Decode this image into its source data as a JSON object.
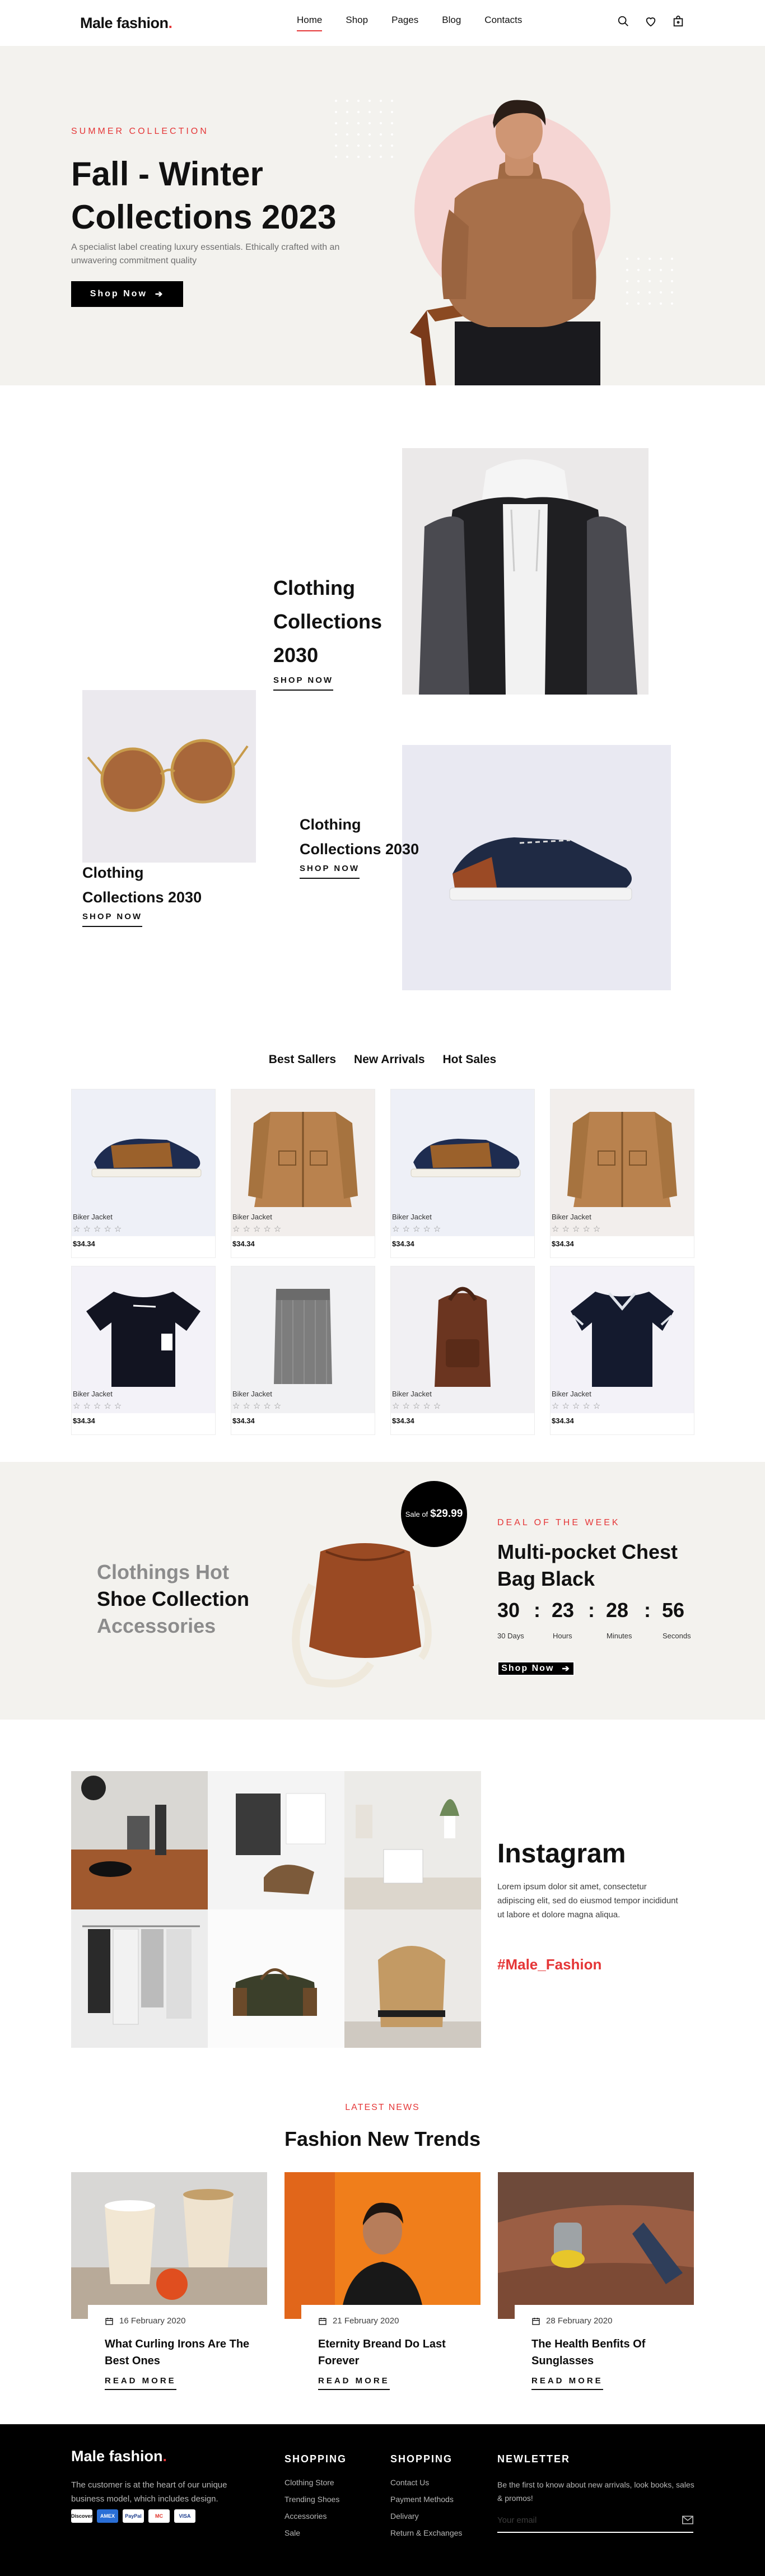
{
  "header": {
    "logo": "Male fashion",
    "logo_dot": ".",
    "nav": [
      "Home",
      "Shop",
      "Pages",
      "Blog",
      "Contacts"
    ],
    "active_nav": "Home",
    "icons": [
      "search-icon",
      "heart-icon",
      "bag-icon"
    ]
  },
  "hero": {
    "kicker": "SUMMER COLLECTION",
    "title": "Fall - Winter Collections 2023",
    "desc": "A specialist label creating luxury essentials. Ethically crafted with an unwavering commitment quality",
    "button": "Shop Now",
    "accent": "#e53637"
  },
  "banners": [
    {
      "title": "Clothing Collections 2030",
      "link": "SHOP NOW"
    },
    {
      "title": "Clothing Collections 2030",
      "link": "SHOP NOW"
    },
    {
      "title": "Clothing Collections 2030",
      "link": "SHOP NOW"
    }
  ],
  "products": {
    "tabs": [
      "Best Sallers",
      "New Arrivals",
      "Hot Sales"
    ],
    "items": [
      {
        "name": "Biker Jacket",
        "stars": "☆☆☆☆☆",
        "price": "$34.34",
        "img": "sneaker"
      },
      {
        "name": "Biker Jacket",
        "stars": "☆☆☆☆☆",
        "price": "$34.34",
        "img": "jacket"
      },
      {
        "name": "Biker Jacket",
        "stars": "☆☆☆☆☆",
        "price": "$34.34",
        "img": "sneaker"
      },
      {
        "name": "Biker Jacket",
        "stars": "☆☆☆☆☆",
        "price": "$34.34",
        "img": "jacket"
      },
      {
        "name": "Biker Jacket",
        "stars": "☆☆☆☆☆",
        "price": "$34.34",
        "img": "tshirt"
      },
      {
        "name": "Biker Jacket",
        "stars": "☆☆☆☆☆",
        "price": "$34.34",
        "img": "scarf"
      },
      {
        "name": "Biker Jacket",
        "stars": "☆☆☆☆☆",
        "price": "$34.34",
        "img": "backpack"
      },
      {
        "name": "Biker Jacket",
        "stars": "☆☆☆☆☆",
        "price": "$34.34",
        "img": "polo"
      }
    ]
  },
  "deal": {
    "categories": [
      "Clothings Hot",
      "Shoe Collection",
      "Accessories"
    ],
    "sale_label": "Sale of",
    "sale_price": "$29.99",
    "kicker": "DEAL OF THE WEEK",
    "title": "Multi-pocket Chest Bag Black",
    "countdown": [
      {
        "value": "30",
        "label": "30 Days"
      },
      {
        "value": "23",
        "label": "Hours"
      },
      {
        "value": "28",
        "label": "Minutes"
      },
      {
        "value": "56",
        "label": "Seconds"
      }
    ],
    "separator": ":",
    "button": "Shop Now"
  },
  "instagram": {
    "title": "Instagram",
    "desc": "Lorem ipsum dolor sit amet, consectetur adipiscing elit, sed do eiusmod tempor incididunt ut labore et dolore magna aliqua.",
    "hashtag": "#Male_Fashion"
  },
  "news": {
    "kicker": "LATEST NEWS",
    "title": "Fashion New Trends",
    "posts": [
      {
        "date": "16 February 2020",
        "title": "What Curling Irons Are The Best Ones",
        "link": "READ MORE"
      },
      {
        "date": "21 February 2020",
        "title": "Eternity Breand Do Last Forever",
        "link": "READ MORE"
      },
      {
        "date": "28 February 2020",
        "title": "The Health Benfits Of Sunglasses",
        "link": "READ MORE"
      }
    ]
  },
  "footer": {
    "logo": "Male fashion",
    "logo_dot": ".",
    "about": "The customer is at the heart of our unique business model, which includes design.",
    "payments": [
      "Discover",
      "AMEX",
      "PayPal",
      "MC",
      "VISA"
    ],
    "col1": {
      "title": "SHOPPING",
      "links": [
        "Clothing Store",
        "Trending Shoes",
        "Accessories",
        "Sale"
      ]
    },
    "col2": {
      "title": "SHOPPING",
      "links": [
        "Contact Us",
        "Payment Methods",
        "Delivary",
        "Return & Exchanges"
      ]
    },
    "newsletter": {
      "title": "NEWLETTER",
      "desc": "Be the first to know about new arrivals, look books, sales & promos!",
      "placeholder": "Your email"
    }
  }
}
